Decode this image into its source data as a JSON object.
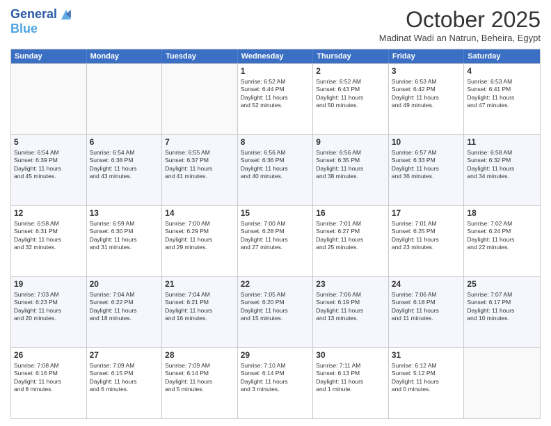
{
  "logo": {
    "line1": "General",
    "line2": "Blue"
  },
  "title": "October 2025",
  "subtitle": "Madinat Wadi an Natrun, Beheira, Egypt",
  "headers": [
    "Sunday",
    "Monday",
    "Tuesday",
    "Wednesday",
    "Thursday",
    "Friday",
    "Saturday"
  ],
  "rows": [
    [
      {
        "day": "",
        "info": ""
      },
      {
        "day": "",
        "info": ""
      },
      {
        "day": "",
        "info": ""
      },
      {
        "day": "1",
        "info": "Sunrise: 6:52 AM\nSunset: 6:44 PM\nDaylight: 11 hours\nand 52 minutes."
      },
      {
        "day": "2",
        "info": "Sunrise: 6:52 AM\nSunset: 6:43 PM\nDaylight: 11 hours\nand 50 minutes."
      },
      {
        "day": "3",
        "info": "Sunrise: 6:53 AM\nSunset: 6:42 PM\nDaylight: 11 hours\nand 49 minutes."
      },
      {
        "day": "4",
        "info": "Sunrise: 6:53 AM\nSunset: 6:41 PM\nDaylight: 11 hours\nand 47 minutes."
      }
    ],
    [
      {
        "day": "5",
        "info": "Sunrise: 6:54 AM\nSunset: 6:39 PM\nDaylight: 11 hours\nand 45 minutes."
      },
      {
        "day": "6",
        "info": "Sunrise: 6:54 AM\nSunset: 6:38 PM\nDaylight: 11 hours\nand 43 minutes."
      },
      {
        "day": "7",
        "info": "Sunrise: 6:55 AM\nSunset: 6:37 PM\nDaylight: 11 hours\nand 41 minutes."
      },
      {
        "day": "8",
        "info": "Sunrise: 6:56 AM\nSunset: 6:36 PM\nDaylight: 11 hours\nand 40 minutes."
      },
      {
        "day": "9",
        "info": "Sunrise: 6:56 AM\nSunset: 6:35 PM\nDaylight: 11 hours\nand 38 minutes."
      },
      {
        "day": "10",
        "info": "Sunrise: 6:57 AM\nSunset: 6:33 PM\nDaylight: 11 hours\nand 36 minutes."
      },
      {
        "day": "11",
        "info": "Sunrise: 6:58 AM\nSunset: 6:32 PM\nDaylight: 11 hours\nand 34 minutes."
      }
    ],
    [
      {
        "day": "12",
        "info": "Sunrise: 6:58 AM\nSunset: 6:31 PM\nDaylight: 11 hours\nand 32 minutes."
      },
      {
        "day": "13",
        "info": "Sunrise: 6:59 AM\nSunset: 6:30 PM\nDaylight: 11 hours\nand 31 minutes."
      },
      {
        "day": "14",
        "info": "Sunrise: 7:00 AM\nSunset: 6:29 PM\nDaylight: 11 hours\nand 29 minutes."
      },
      {
        "day": "15",
        "info": "Sunrise: 7:00 AM\nSunset: 6:28 PM\nDaylight: 11 hours\nand 27 minutes."
      },
      {
        "day": "16",
        "info": "Sunrise: 7:01 AM\nSunset: 6:27 PM\nDaylight: 11 hours\nand 25 minutes."
      },
      {
        "day": "17",
        "info": "Sunrise: 7:01 AM\nSunset: 6:25 PM\nDaylight: 11 hours\nand 23 minutes."
      },
      {
        "day": "18",
        "info": "Sunrise: 7:02 AM\nSunset: 6:24 PM\nDaylight: 11 hours\nand 22 minutes."
      }
    ],
    [
      {
        "day": "19",
        "info": "Sunrise: 7:03 AM\nSunset: 6:23 PM\nDaylight: 11 hours\nand 20 minutes."
      },
      {
        "day": "20",
        "info": "Sunrise: 7:04 AM\nSunset: 6:22 PM\nDaylight: 11 hours\nand 18 minutes."
      },
      {
        "day": "21",
        "info": "Sunrise: 7:04 AM\nSunset: 6:21 PM\nDaylight: 11 hours\nand 16 minutes."
      },
      {
        "day": "22",
        "info": "Sunrise: 7:05 AM\nSunset: 6:20 PM\nDaylight: 11 hours\nand 15 minutes."
      },
      {
        "day": "23",
        "info": "Sunrise: 7:06 AM\nSunset: 6:19 PM\nDaylight: 11 hours\nand 13 minutes."
      },
      {
        "day": "24",
        "info": "Sunrise: 7:06 AM\nSunset: 6:18 PM\nDaylight: 11 hours\nand 11 minutes."
      },
      {
        "day": "25",
        "info": "Sunrise: 7:07 AM\nSunset: 6:17 PM\nDaylight: 11 hours\nand 10 minutes."
      }
    ],
    [
      {
        "day": "26",
        "info": "Sunrise: 7:08 AM\nSunset: 6:16 PM\nDaylight: 11 hours\nand 8 minutes."
      },
      {
        "day": "27",
        "info": "Sunrise: 7:09 AM\nSunset: 6:15 PM\nDaylight: 11 hours\nand 6 minutes."
      },
      {
        "day": "28",
        "info": "Sunrise: 7:09 AM\nSunset: 6:14 PM\nDaylight: 11 hours\nand 5 minutes."
      },
      {
        "day": "29",
        "info": "Sunrise: 7:10 AM\nSunset: 6:14 PM\nDaylight: 11 hours\nand 3 minutes."
      },
      {
        "day": "30",
        "info": "Sunrise: 7:11 AM\nSunset: 6:13 PM\nDaylight: 11 hours\nand 1 minute."
      },
      {
        "day": "31",
        "info": "Sunrise: 6:12 AM\nSunset: 5:12 PM\nDaylight: 11 hours\nand 0 minutes."
      },
      {
        "day": "",
        "info": ""
      }
    ]
  ]
}
